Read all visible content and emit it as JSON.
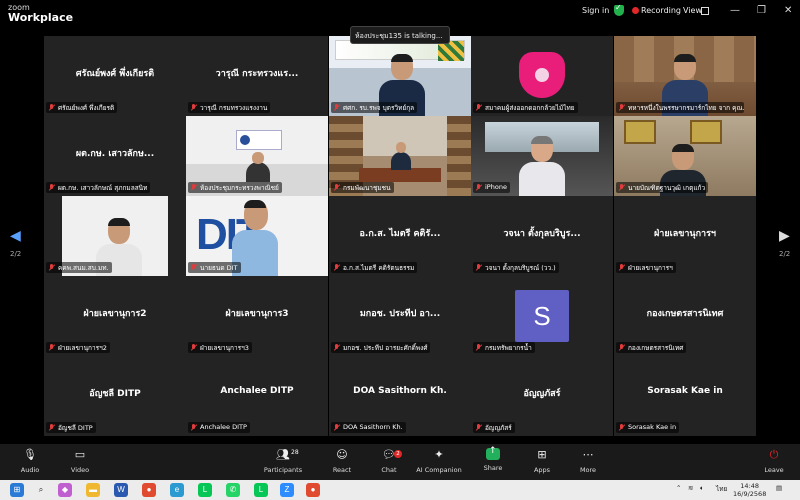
{
  "app": {
    "logo_line1": "zoom",
    "logo_line2": "Workplace"
  },
  "titlebar": {
    "sign_in": "Sign in",
    "recording": "Recording",
    "view": "View",
    "minimize": "—",
    "restore": "❐",
    "close": "✕"
  },
  "talking_indicator": "ห้องประชุม135 is talking...",
  "tiles": [
    {
      "center": "ศรัณย์พงศ์ พึ่งเกียรติ",
      "label": "ศรัณย์พงศ์ พึ่งเกียรติ"
    },
    {
      "center": "วารุณี กระทรวงแร...",
      "label": "วารุณี กรมทรวงแรงงาน"
    },
    {
      "center": "",
      "label": "ศศก. รบ.รพจ บุตรวิทย์กุล"
    },
    {
      "center": "",
      "label": "สมาคมผู้ส่งออกดอกกล้วยไม้ไทย"
    },
    {
      "center": "",
      "label": "ทหารหนึ่งในพรรษากรมาร์กไทย จาก คุณ..."
    },
    {
      "center": "ผต.กษ. เสาวลักษ...",
      "label": "ผต.กษ. เสาวลักษณ์ สุภกมลสนิท"
    },
    {
      "center": "",
      "label": "ห้องประชุมกระทรวงพาณิชย์"
    },
    {
      "center": "",
      "label": "กรมพัฒนาชุมชน"
    },
    {
      "center": "",
      "label": "iPhone"
    },
    {
      "center": "",
      "label": "นายบัณฑิตฐานวุฒิ เกตุแก้ว"
    },
    {
      "center": "",
      "label": "คคพ.สนม.สบ.มท."
    },
    {
      "center": "",
      "label": "นายธนด DIT"
    },
    {
      "center": "อ.ก.ส. ไมตรี คติรั...",
      "label": "อ.ก.ส.ไมตรี คติรัตนธรรม"
    },
    {
      "center": "วจนา ตั้งกุลบริบูร...",
      "label": "วจนา ตั้งกุลบริบูรณ์ (วว.)"
    },
    {
      "center": "ฝ่ายเลขานุการฯ",
      "label": "ฝ่ายเลขานุการฯ"
    },
    {
      "center": "ฝ่ายเลขานุการ2",
      "label": "ฝ่ายเลขานุการฯ2"
    },
    {
      "center": "ฝ่ายเลขานุการ3",
      "label": "ฝ่ายเลขานุการฯ3"
    },
    {
      "center": "มกอช. ประทีป อา...",
      "label": "มกอช. ประทีป อารยะศักดิ์พงศ์"
    },
    {
      "center": "",
      "label": "กรมทรัพยากรน้ำ",
      "avatar": "S"
    },
    {
      "center": "กองเกษตรสารนิเทศ",
      "label": "กองเกษตรสารนิเทศ"
    },
    {
      "center": "อัญชลี DITP",
      "label": "อัญชลี DITP"
    },
    {
      "center": "Anchalee DITP",
      "label": "Anchalee DITP"
    },
    {
      "center": "DOA Sasithorn Kh.",
      "label": "DOA Sasithorn Kh."
    },
    {
      "center": "อัญญภัสร์",
      "label": "อัญญภัสร์"
    },
    {
      "center": "Sorasak Kae in",
      "label": "Sorasak Kae in"
    }
  ],
  "pagination": {
    "left": "2/2",
    "right": "2/2"
  },
  "toolbar": {
    "audio": "Audio",
    "video": "Video",
    "participants": "Participants",
    "participants_count": "28",
    "react": "React",
    "chat": "Chat",
    "chat_badge": "2",
    "ai_companion": "AI Companion",
    "share": "Share",
    "apps": "Apps",
    "more": "More",
    "leave": "Leave"
  },
  "taskbar": {
    "lang": "ไทย",
    "time": "14:48",
    "date": "16/9/2568"
  },
  "colors": {
    "tile_bg": "#232323",
    "accent_blue": "#5aa0ff",
    "recording_red": "#e02828",
    "share_green": "#22b05c",
    "avatar_purple": "#5f5fc4"
  }
}
